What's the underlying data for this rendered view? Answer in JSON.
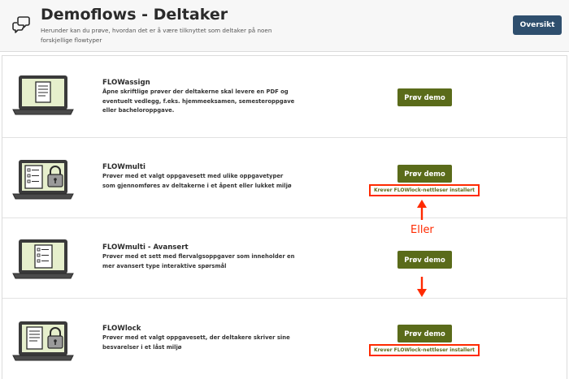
{
  "header": {
    "title": "Demoflows - Deltaker",
    "subtitle": "Herunder kan du prøve, hvordan det er å være tilknyttet som deltaker på noen forskjellige flowtyper",
    "overview_button": "Oversikt",
    "logo_icon": "chat-bubbles-icon"
  },
  "flows": [
    {
      "name": "FLOWassign",
      "description": "Åpne skriftlige prøver der deltakerne skal levere en PDF og eventuelt vedlegg, f.eks. hjemmeeksamen, semesteroppgave eller bacheloroppgave.",
      "button": "Prøv demo",
      "icon": "laptop-document-icon"
    },
    {
      "name": "FLOWmulti",
      "description": "Prøver med et valgt oppgavesett med ulike oppgavetyper som gjennomføres av deltakerne i et åpent eller lukket miljø",
      "button": "Prøv demo",
      "requirement": "Krever FLOWlock-nettleser installert",
      "icon": "laptop-checklist-lock-icon"
    },
    {
      "name": "FLOWmulti - Avansert",
      "description": "Prøver med et sett med flervalgsoppgaver som inneholder en mer avansert type interaktive spørsmål",
      "button": "Prøv demo",
      "icon": "laptop-checklist-icon"
    },
    {
      "name": "FLOWlock",
      "description": "Prøver med et valgt oppgavesett, der deltakere skriver sine besvarelser i et låst miljø",
      "button": "Prøv demo",
      "requirement": "Krever FLOWlock-nettleser installert",
      "icon": "laptop-document-lock-icon"
    }
  ],
  "annotation": {
    "label": "Eller",
    "color": "#ff2a00"
  },
  "colors": {
    "demo_button": "#5a6b1a",
    "overview_button": "#2f4f6e",
    "laptop_screen": "#e6efcc"
  }
}
